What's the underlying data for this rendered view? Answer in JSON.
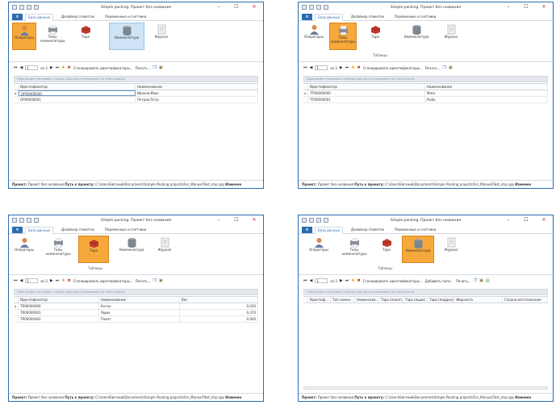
{
  "common": {
    "window_title": "Simple packing. Проект без названия",
    "file_tab": "Ф",
    "tabs": [
      "База данных",
      "Дизайнер этикеток",
      "Переменные и счетчики"
    ],
    "group_label": "Таблицы",
    "ribbon": {
      "operators": "Операторы",
      "nom_types": "Типы номенклатуры",
      "tara": "Тара",
      "nomenclature": "Номенклатура",
      "journal": "Журнал"
    },
    "toolbar": {
      "page": "1",
      "of": "из 2",
      "generate": "Сгенерировать идентификаторы...",
      "print": "Печать..."
    },
    "group_hint": "Перетащите заголовок столбца сюда для группировки по этой колонке",
    "status": {
      "project_label": "Проект:",
      "project_value": "Проект без названия",
      "path_label": "Путь к проекту:",
      "path_value": "C:\\Users\\Евгений\\Documents\\Simple Packing projects\\For_Manual\\Test_imp.spp",
      "changes_label": "Изменен"
    },
    "colors": {
      "accent": "#2b6cb0",
      "selected": "#f6a83b",
      "close": "#c42b1c"
    }
  },
  "windows": [
    {
      "selected_button": "operators",
      "columns": [
        "Идентификатор",
        "Наименование"
      ],
      "rows": [
        [
          "OP00000000",
          "Иванов Иван"
        ],
        [
          "OP00000001",
          "Петров Петр"
        ]
      ]
    },
    {
      "selected_button": "nom_types",
      "columns": [
        "Идентификатор",
        "Наименование"
      ],
      "rows": [
        [
          "ТП00000000",
          "Мясо"
        ],
        [
          "ТП00000001",
          "Рыба"
        ]
      ]
    },
    {
      "selected_button": "tara",
      "columns": [
        "Идентификатор",
        "Наименование",
        "Вес"
      ],
      "rows": [
        [
          "TR00000000",
          "Коток",
          "0,020"
        ],
        [
          "TR00000001",
          "Ящик",
          "0,370"
        ],
        [
          "TR00000002",
          "Пакет",
          "0,000"
        ]
      ]
    },
    {
      "selected_button": "nomenclature",
      "toolbar_extra": "Добавить поле...",
      "columns": [
        "Идентиф...",
        "Тип номен...",
        "Наименова...",
        "Тара (пакет)",
        "Тара (ящик)",
        "Тара (поддон)",
        "Жирность",
        "Страна изготовления"
      ],
      "rows": []
    }
  ]
}
